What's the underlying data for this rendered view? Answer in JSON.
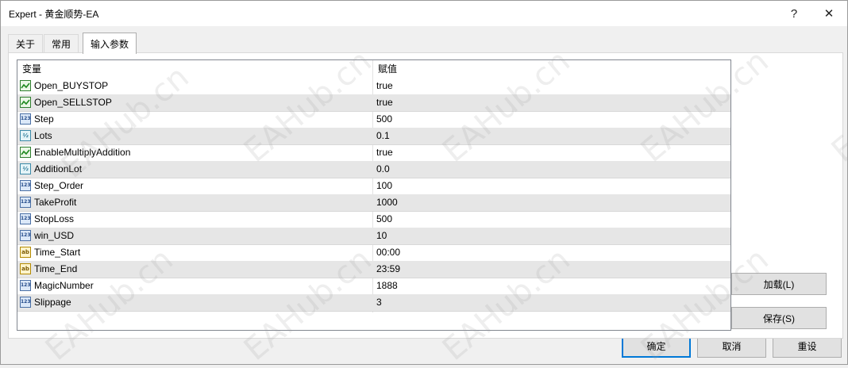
{
  "window": {
    "title": "Expert - 黄金顺势-EA",
    "help_glyph": "?",
    "close_glyph": "✕"
  },
  "tabs": [
    {
      "label": "关于",
      "active": false
    },
    {
      "label": "常用",
      "active": false
    },
    {
      "label": "输入参数",
      "active": true
    }
  ],
  "grid": {
    "col_variable": "变量",
    "col_value": "赋值",
    "rows": [
      {
        "icon": "bool-icon",
        "name": "Open_BUYSTOP",
        "value": "true"
      },
      {
        "icon": "bool-icon",
        "name": "Open_SELLSTOP",
        "value": "true"
      },
      {
        "icon": "int-icon",
        "name": "Step",
        "value": "500"
      },
      {
        "icon": "double-icon",
        "name": "Lots",
        "value": "0.1"
      },
      {
        "icon": "bool-icon",
        "name": "EnableMultiplyAddition",
        "value": "true"
      },
      {
        "icon": "double-icon",
        "name": "AdditionLot",
        "value": "0.0"
      },
      {
        "icon": "int-icon",
        "name": "Step_Order",
        "value": "100"
      },
      {
        "icon": "int-icon",
        "name": "TakeProfit",
        "value": "1000"
      },
      {
        "icon": "int-icon",
        "name": "StopLoss",
        "value": "500"
      },
      {
        "icon": "int-icon",
        "name": "win_USD",
        "value": "10"
      },
      {
        "icon": "string-icon",
        "name": "Time_Start",
        "value": "00:00"
      },
      {
        "icon": "string-icon",
        "name": "Time_End",
        "value": "23:59"
      },
      {
        "icon": "int-icon",
        "name": "MagicNumber",
        "value": "1888"
      },
      {
        "icon": "int-icon",
        "name": "Slippage",
        "value": "3"
      }
    ]
  },
  "side_buttons": {
    "load": "加载(L)",
    "save": "保存(S)"
  },
  "footer_buttons": {
    "ok": "确定",
    "cancel": "取消",
    "reset": "重设"
  },
  "watermark": "EAHub.cn"
}
